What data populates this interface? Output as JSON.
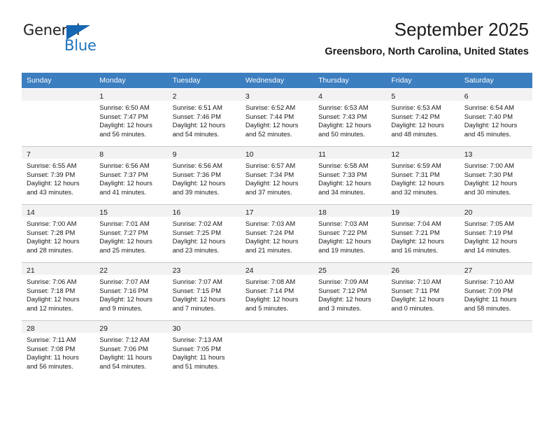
{
  "logo": {
    "primary_text": "General",
    "secondary_text": "Blue",
    "primary_color": "#231f20",
    "secondary_color": "#2073bc",
    "triangle_icon": "triangle-icon"
  },
  "header": {
    "title": "September 2025",
    "subtitle": "Greensboro, North Carolina, United States"
  },
  "theme": {
    "header_bg": "#3c7ebf",
    "header_text": "#ffffff",
    "daynum_band_bg": "#f2f2f2",
    "cell_bg": "#ffffff",
    "separator": "#c8c8c8",
    "text": "#1a1a1a"
  },
  "calendar": {
    "weekday_headers": [
      "Sunday",
      "Monday",
      "Tuesday",
      "Wednesday",
      "Thursday",
      "Friday",
      "Saturday"
    ],
    "weeks": [
      [
        {
          "day": "",
          "empty": true,
          "lines": []
        },
        {
          "day": "1",
          "empty": false,
          "lines": [
            "Sunrise: 6:50 AM",
            "Sunset: 7:47 PM",
            "Daylight: 12 hours",
            "and 56 minutes."
          ]
        },
        {
          "day": "2",
          "empty": false,
          "lines": [
            "Sunrise: 6:51 AM",
            "Sunset: 7:46 PM",
            "Daylight: 12 hours",
            "and 54 minutes."
          ]
        },
        {
          "day": "3",
          "empty": false,
          "lines": [
            "Sunrise: 6:52 AM",
            "Sunset: 7:44 PM",
            "Daylight: 12 hours",
            "and 52 minutes."
          ]
        },
        {
          "day": "4",
          "empty": false,
          "lines": [
            "Sunrise: 6:53 AM",
            "Sunset: 7:43 PM",
            "Daylight: 12 hours",
            "and 50 minutes."
          ]
        },
        {
          "day": "5",
          "empty": false,
          "lines": [
            "Sunrise: 6:53 AM",
            "Sunset: 7:42 PM",
            "Daylight: 12 hours",
            "and 48 minutes."
          ]
        },
        {
          "day": "6",
          "empty": false,
          "lines": [
            "Sunrise: 6:54 AM",
            "Sunset: 7:40 PM",
            "Daylight: 12 hours",
            "and 45 minutes."
          ]
        }
      ],
      [
        {
          "day": "7",
          "empty": false,
          "lines": [
            "Sunrise: 6:55 AM",
            "Sunset: 7:39 PM",
            "Daylight: 12 hours",
            "and 43 minutes."
          ]
        },
        {
          "day": "8",
          "empty": false,
          "lines": [
            "Sunrise: 6:56 AM",
            "Sunset: 7:37 PM",
            "Daylight: 12 hours",
            "and 41 minutes."
          ]
        },
        {
          "day": "9",
          "empty": false,
          "lines": [
            "Sunrise: 6:56 AM",
            "Sunset: 7:36 PM",
            "Daylight: 12 hours",
            "and 39 minutes."
          ]
        },
        {
          "day": "10",
          "empty": false,
          "lines": [
            "Sunrise: 6:57 AM",
            "Sunset: 7:34 PM",
            "Daylight: 12 hours",
            "and 37 minutes."
          ]
        },
        {
          "day": "11",
          "empty": false,
          "lines": [
            "Sunrise: 6:58 AM",
            "Sunset: 7:33 PM",
            "Daylight: 12 hours",
            "and 34 minutes."
          ]
        },
        {
          "day": "12",
          "empty": false,
          "lines": [
            "Sunrise: 6:59 AM",
            "Sunset: 7:31 PM",
            "Daylight: 12 hours",
            "and 32 minutes."
          ]
        },
        {
          "day": "13",
          "empty": false,
          "lines": [
            "Sunrise: 7:00 AM",
            "Sunset: 7:30 PM",
            "Daylight: 12 hours",
            "and 30 minutes."
          ]
        }
      ],
      [
        {
          "day": "14",
          "empty": false,
          "lines": [
            "Sunrise: 7:00 AM",
            "Sunset: 7:28 PM",
            "Daylight: 12 hours",
            "and 28 minutes."
          ]
        },
        {
          "day": "15",
          "empty": false,
          "lines": [
            "Sunrise: 7:01 AM",
            "Sunset: 7:27 PM",
            "Daylight: 12 hours",
            "and 25 minutes."
          ]
        },
        {
          "day": "16",
          "empty": false,
          "lines": [
            "Sunrise: 7:02 AM",
            "Sunset: 7:25 PM",
            "Daylight: 12 hours",
            "and 23 minutes."
          ]
        },
        {
          "day": "17",
          "empty": false,
          "lines": [
            "Sunrise: 7:03 AM",
            "Sunset: 7:24 PM",
            "Daylight: 12 hours",
            "and 21 minutes."
          ]
        },
        {
          "day": "18",
          "empty": false,
          "lines": [
            "Sunrise: 7:03 AM",
            "Sunset: 7:22 PM",
            "Daylight: 12 hours",
            "and 19 minutes."
          ]
        },
        {
          "day": "19",
          "empty": false,
          "lines": [
            "Sunrise: 7:04 AM",
            "Sunset: 7:21 PM",
            "Daylight: 12 hours",
            "and 16 minutes."
          ]
        },
        {
          "day": "20",
          "empty": false,
          "lines": [
            "Sunrise: 7:05 AM",
            "Sunset: 7:19 PM",
            "Daylight: 12 hours",
            "and 14 minutes."
          ]
        }
      ],
      [
        {
          "day": "21",
          "empty": false,
          "lines": [
            "Sunrise: 7:06 AM",
            "Sunset: 7:18 PM",
            "Daylight: 12 hours",
            "and 12 minutes."
          ]
        },
        {
          "day": "22",
          "empty": false,
          "lines": [
            "Sunrise: 7:07 AM",
            "Sunset: 7:16 PM",
            "Daylight: 12 hours",
            "and 9 minutes."
          ]
        },
        {
          "day": "23",
          "empty": false,
          "lines": [
            "Sunrise: 7:07 AM",
            "Sunset: 7:15 PM",
            "Daylight: 12 hours",
            "and 7 minutes."
          ]
        },
        {
          "day": "24",
          "empty": false,
          "lines": [
            "Sunrise: 7:08 AM",
            "Sunset: 7:14 PM",
            "Daylight: 12 hours",
            "and 5 minutes."
          ]
        },
        {
          "day": "25",
          "empty": false,
          "lines": [
            "Sunrise: 7:09 AM",
            "Sunset: 7:12 PM",
            "Daylight: 12 hours",
            "and 3 minutes."
          ]
        },
        {
          "day": "26",
          "empty": false,
          "lines": [
            "Sunrise: 7:10 AM",
            "Sunset: 7:11 PM",
            "Daylight: 12 hours",
            "and 0 minutes."
          ]
        },
        {
          "day": "27",
          "empty": false,
          "lines": [
            "Sunrise: 7:10 AM",
            "Sunset: 7:09 PM",
            "Daylight: 11 hours",
            "and 58 minutes."
          ]
        }
      ],
      [
        {
          "day": "28",
          "empty": false,
          "lines": [
            "Sunrise: 7:11 AM",
            "Sunset: 7:08 PM",
            "Daylight: 11 hours",
            "and 56 minutes."
          ]
        },
        {
          "day": "29",
          "empty": false,
          "lines": [
            "Sunrise: 7:12 AM",
            "Sunset: 7:06 PM",
            "Daylight: 11 hours",
            "and 54 minutes."
          ]
        },
        {
          "day": "30",
          "empty": false,
          "lines": [
            "Sunrise: 7:13 AM",
            "Sunset: 7:05 PM",
            "Daylight: 11 hours",
            "and 51 minutes."
          ]
        },
        {
          "day": "",
          "empty": true,
          "lines": []
        },
        {
          "day": "",
          "empty": true,
          "lines": []
        },
        {
          "day": "",
          "empty": true,
          "lines": []
        },
        {
          "day": "",
          "empty": true,
          "lines": []
        }
      ]
    ]
  }
}
